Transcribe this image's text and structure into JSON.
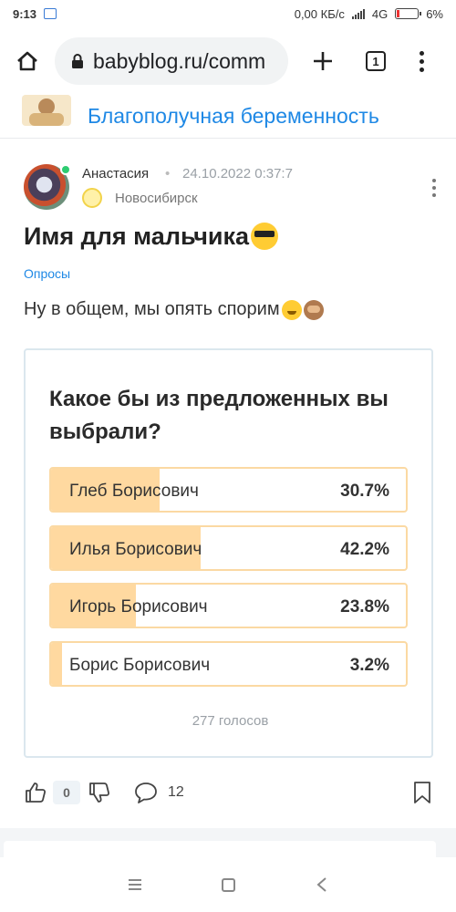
{
  "status_bar": {
    "time": "9:13",
    "net_speed": "0,00 КБ/с",
    "network": "4G",
    "battery": "6%"
  },
  "browser": {
    "url": "babyblog.ru/comm",
    "tab_count": "1"
  },
  "community": {
    "name": "Благополучная беременность"
  },
  "post": {
    "author": "Анастасия",
    "separator": "•",
    "date": "24.10.2022 0:37:7",
    "city": "Новосибирск",
    "title": "Имя для мальчика",
    "category": "Опросы",
    "text": "Ну в общем, мы опять спорим"
  },
  "poll": {
    "question": "Какое бы из предложенных вы выбрали?",
    "options": [
      {
        "label": "Глеб Борисович",
        "percent": "30.7%",
        "value": 30.7
      },
      {
        "label": "Илья Борисович",
        "percent": "42.2%",
        "value": 42.2
      },
      {
        "label": "Игорь Борисович",
        "percent": "23.8%",
        "value": 23.8
      },
      {
        "label": "Борис Борисович",
        "percent": "3.2%",
        "value": 3.2
      }
    ],
    "votes": "277 голосов"
  },
  "actions": {
    "likes": "0",
    "comments": "12"
  },
  "colors": {
    "accent": "#1e88e5",
    "poll_fill": "#ffd9a0",
    "poll_border": "#fbd9a3",
    "online": "#2ecc71"
  }
}
